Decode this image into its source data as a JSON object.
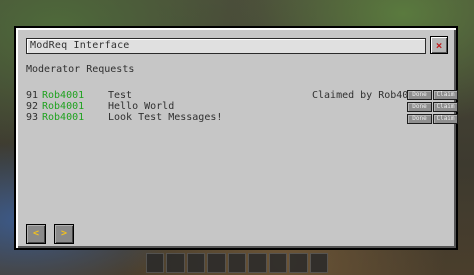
{
  "window": {
    "title": "ModReq Interface",
    "close_icon": "×"
  },
  "heading": "Moderator Requests",
  "requests": [
    {
      "id": "91",
      "user": "Rob4001",
      "message": "Test"
    },
    {
      "id": "92",
      "user": "Rob4001",
      "message": "Hello World"
    },
    {
      "id": "93",
      "user": "Rob4001",
      "message": "Look Test Messages!"
    }
  ],
  "claimed_text": "Claimed by Rob4001",
  "buttons": {
    "done": "Done",
    "claim": "Claim"
  },
  "pagination": {
    "prev_icon": "<",
    "next_icon": ">"
  },
  "colors": {
    "username": "#1fa21f",
    "nav_arrow": "#f0c020",
    "close_x": "#c02020"
  }
}
